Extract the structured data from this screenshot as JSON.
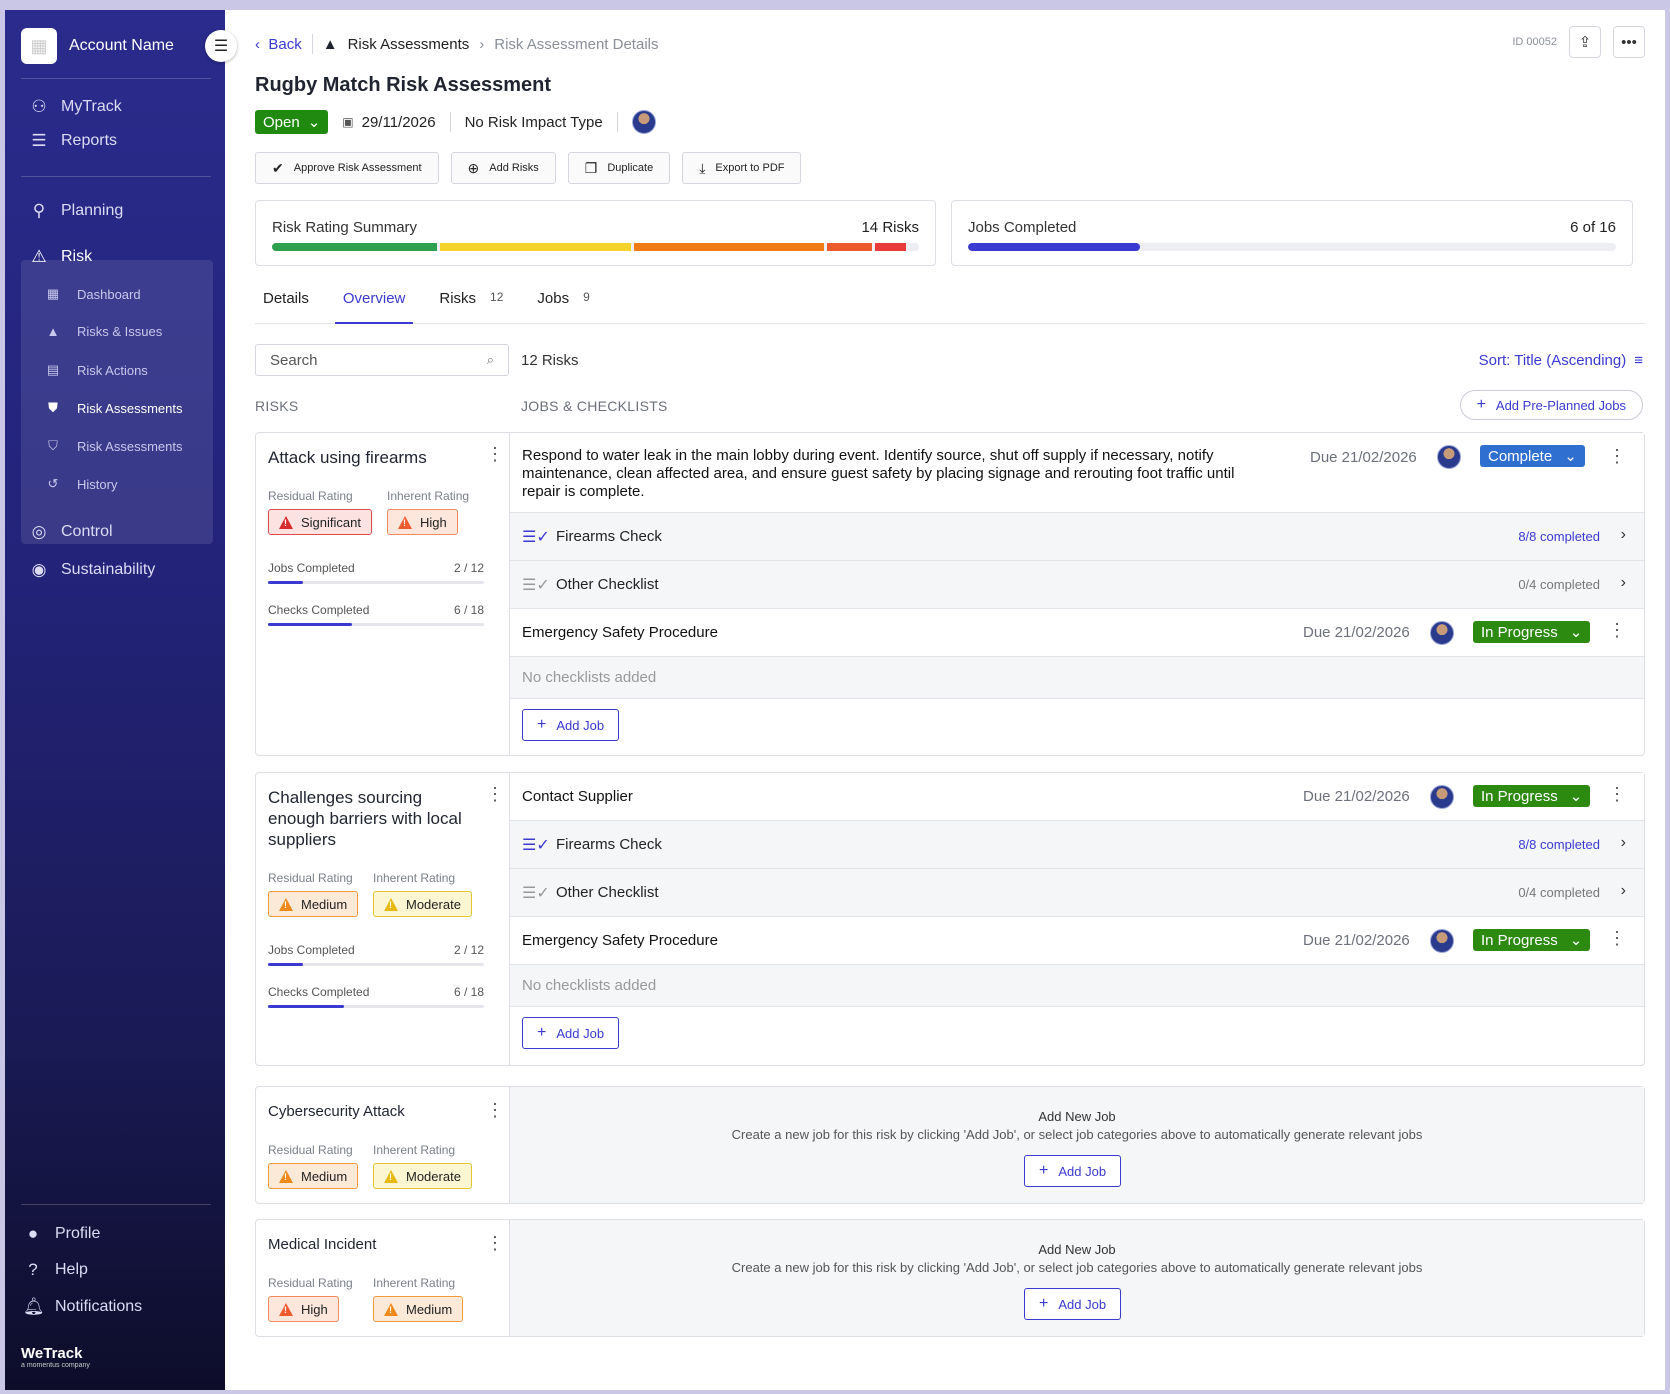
{
  "sidebar": {
    "account_name": "Account Name",
    "top_items": [
      {
        "label": "MyTrack",
        "icon": "person-icon"
      },
      {
        "label": "Reports",
        "icon": "list-icon"
      }
    ],
    "planning": "Planning",
    "risk": "Risk",
    "risk_sub": [
      {
        "label": "Dashboard",
        "icon": "dashboard-icon"
      },
      {
        "label": "Risks & Issues",
        "icon": "warning-icon"
      },
      {
        "label": "Risk Actions",
        "icon": "checklist-icon"
      },
      {
        "label": "Risk Assessments",
        "icon": "shield-icon",
        "active": true
      },
      {
        "label": "Risk Assessments",
        "icon": "shield-icon"
      },
      {
        "label": "History",
        "icon": "history-icon"
      }
    ],
    "control": "Control",
    "sustainability": "Sustainability",
    "bottom_items": [
      {
        "label": "Profile",
        "icon": "profile-icon"
      },
      {
        "label": "Help",
        "icon": "help-icon"
      },
      {
        "label": "Notifications",
        "icon": "bell-icon"
      }
    ],
    "brand": "WeTrack",
    "brand_sub": "a momentus company"
  },
  "breadcrumb": {
    "back": "Back",
    "section": "Risk Assessments",
    "current": "Risk Assessment Details"
  },
  "record_id": "ID 00052",
  "page_title": "Rugby Match Risk Assessment",
  "meta": {
    "status": "Open",
    "date": "29/11/2026",
    "impact_type": "No Risk Impact Type"
  },
  "actions": [
    "Approve Risk Assessment",
    "Add Risks",
    "Duplicate",
    "Export to PDF"
  ],
  "summary": {
    "risk_rating_label": "Risk Rating Summary",
    "risk_count": "14 Risks",
    "segments": [
      {
        "color": "#2e9e4f",
        "fraction": 0.26
      },
      {
        "color": "#f5d32a",
        "fraction": 0.3
      },
      {
        "color": "#f07c14",
        "fraction": 0.3
      },
      {
        "color": "#ec5a2c",
        "fraction": 0.07
      },
      {
        "color": "#e93a3a",
        "fraction": 0.05
      }
    ],
    "jobs_label": "Jobs Completed",
    "jobs_value": "6 of 16",
    "jobs_fraction": 0.265
  },
  "tabs": [
    {
      "label": "Details",
      "count": ""
    },
    {
      "label": "Overview",
      "count": ""
    },
    {
      "label": "Risks",
      "count": "12"
    },
    {
      "label": "Jobs",
      "count": "9"
    }
  ],
  "search_placeholder": "Search",
  "risk_count_label": "12 Risks",
  "sort_label": "Sort: Title (Ascending)",
  "col_risks": "RISKS",
  "col_jobs": "JOBS & CHECKLISTS",
  "add_preplanned": "Add Pre-Planned Jobs",
  "labels": {
    "residual": "Residual Rating",
    "inherent": "Inherent Rating",
    "jobs_completed": "Jobs Completed",
    "checks_completed": "Checks Completed",
    "add_job": "Add Job",
    "no_checklists": "No checklists added",
    "add_new_job": "Add New Job",
    "add_new_job_desc": "Create a new job for this risk by clicking 'Add Job', or select job categories above to automatically generate relevant jobs"
  },
  "risks": [
    {
      "name": "Attack using firearms",
      "residual": "Significant",
      "inherent": "High",
      "jobs_completed": "2 / 12",
      "jobs_fraction": 0.16,
      "checks_completed": "6 / 18",
      "checks_fraction": 0.39,
      "jobs": [
        {
          "title": "Respond to water leak in the main lobby during event. Identify source, shut off supply if necessary, notify maintenance, clean affected area, and ensure guest safety by placing signage and rerouting foot traffic until repair is complete.",
          "due": "Due 21/02/2026",
          "status": "Complete",
          "checklists": [
            {
              "title": "Firearms Check",
              "count": "8/8 completed"
            },
            {
              "title": "Other Checklist",
              "count": "0/4 completed"
            }
          ]
        },
        {
          "title": "Emergency Safety Procedure",
          "due": "Due 21/02/2026",
          "status": "In Progress",
          "checklists": []
        }
      ]
    },
    {
      "name": "Challenges sourcing enough barriers with local suppliers",
      "residual": "Medium",
      "inherent": "Moderate",
      "jobs_completed": "2 / 12",
      "jobs_fraction": 0.16,
      "checks_completed": "6 / 18",
      "checks_fraction": 0.35,
      "jobs": [
        {
          "title": "Contact Supplier",
          "due": "Due 21/02/2026",
          "status": "In Progress",
          "checklists": [
            {
              "title": "Firearms Check",
              "count": "8/8 completed"
            },
            {
              "title": "Other Checklist",
              "count": "0/4 completed"
            }
          ]
        },
        {
          "title": "Emergency Safety Procedure",
          "due": "Due 21/02/2026",
          "status": "In Progress",
          "checklists": []
        }
      ]
    },
    {
      "name": "Cybersecurity Attack",
      "residual": "Medium",
      "inherent": "Moderate"
    },
    {
      "name": "Medical Incident",
      "residual": "High",
      "inherent": "Medium"
    }
  ]
}
